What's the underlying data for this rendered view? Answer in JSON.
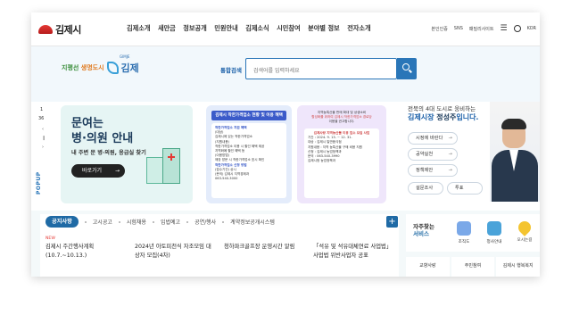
{
  "header": {
    "logo_text": "김제시",
    "nav": [
      "김제소개",
      "새만금",
      "정보공개",
      "민원안내",
      "김제소식",
      "시민참여",
      "분야별 정보",
      "전자소개"
    ],
    "util": {
      "auth": "본인인증",
      "sns": "SNS",
      "menu": "패밀리사이트",
      "lang": "KOR"
    }
  },
  "hero": {
    "slogan_left": "지평선",
    "slogan_right": "생명도시",
    "brand": "김제",
    "brand_small": "GIMJE",
    "search_label": "통합검색",
    "search_placeholder": "검색어를 입력하세요"
  },
  "popup": {
    "page_current": "1",
    "page_total": "36",
    "label": "POPUP"
  },
  "banner1": {
    "line1": "문여는",
    "line2": "병·의원 안내",
    "sub": "내 주변 문 병·의원, 응급실 찾기",
    "button": "바로가기",
    "button_arrow": "→"
  },
  "banner2": {
    "title": "김제시 착한가격업소 현황 및 이용 혜택",
    "lines": [
      "착한가격업소 지원 혜택",
      "(대상)",
      "김제시에 있는 착한가격업소",
      "(지원내용)",
      "착한가격업소 이용 시 할인 혜택 제공",
      "지역화폐 할인 혜택 등",
      "(이용방법)",
      "매장 방문 시 착한가격업소 표시 확인",
      "착한가격업소 신청 방법",
      "(접수기간) 상시",
      "(문의) 김제시 지역경제과",
      "063-540-3000"
    ]
  },
  "banner3": {
    "top": [
      "지역농특산물 판매 확대 및 상생소비",
      "활성화를 위하여 김제시 착한가격업소 경로당",
      "이용을 권고합니다."
    ],
    "card": [
      "김제사랑 지역농산물 이용 업소 모집 사업",
      "기간 : 2024. 9. 13. ~ 12. 31.",
      "대상 : 김제시 일반음식점",
      "지원내용 : 지역 농특산물 구매 비용 지원",
      "신청 : 김제시 농업정책과",
      "문의 : 063-540-3990",
      "김제시청 농업정책과"
    ]
  },
  "mayor": {
    "line1": "전북의 4대 도시로 웅비하는",
    "line2_prefix": "김제시장",
    "name": "정성주",
    "line2_suffix": "입니다.",
    "links": [
      "시정에 바란다",
      "공약실천",
      "정책제안"
    ],
    "row": [
      "설문조사",
      "투표"
    ],
    "arrow": "→"
  },
  "notice": {
    "tabs": [
      "공지사항",
      "고시공고",
      "시험채용",
      "입법예고",
      "공연/행사",
      "계약정보공개시스템"
    ],
    "plus": "+",
    "posts": [
      {
        "new": "NEW",
        "title": "김제시 주간행사계획 (10.7.~10.13.)"
      },
      {
        "new": "",
        "title": "2024년 아토피천식 자조모임 대상자 모집(4차)"
      },
      {
        "new": "",
        "title": "청하파크골프장 운영시간 알림"
      },
      {
        "new": "",
        "title": "「석유 및 석유대체연료 사업법」 사업법 위반사업자 공표"
      }
    ]
  },
  "services": {
    "title_line1": "자주찾는",
    "title_line2": "서비스",
    "items": [
      {
        "label": "조직도",
        "icon": "org-chart-icon",
        "color": "#7aa8e8"
      },
      {
        "label": "청사안내",
        "icon": "building-icon",
        "color": "#4aa3d9"
      },
      {
        "label": "오시는길",
        "icon": "map-pin-icon",
        "color": "#f4c430"
      }
    ],
    "bottom": [
      "교향사랑",
      "주민참여",
      "김제시 행복복지"
    ]
  }
}
